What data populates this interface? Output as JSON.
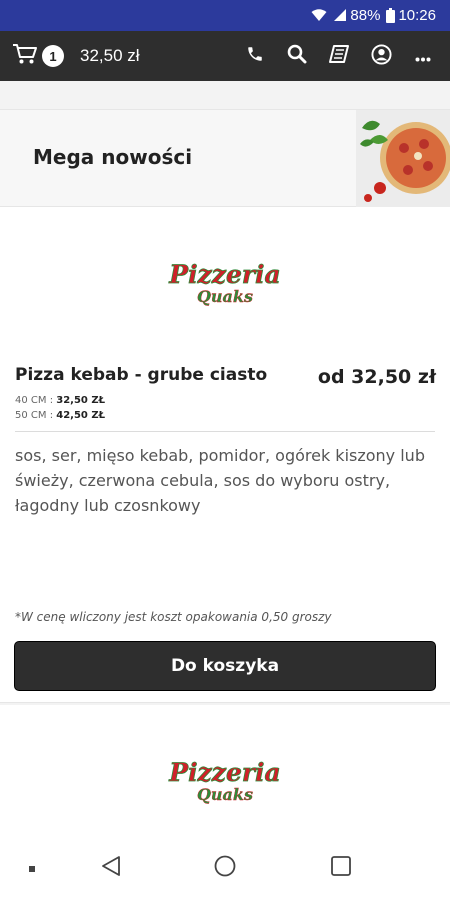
{
  "status_bar": {
    "battery": "88%",
    "time": "10:26"
  },
  "app_bar": {
    "cart_count": "1",
    "cart_total": "32,50 zł"
  },
  "category": {
    "title": "Mega nowości"
  },
  "product": {
    "logo_line1": "Pizzeria",
    "logo_line2": "Quaks",
    "name": "Pizza kebab - grube ciasto",
    "price": "od 32,50 zł",
    "sizes": [
      {
        "label": "40 CM :",
        "price": "32,50 ZŁ"
      },
      {
        "label": "50 CM :",
        "price": "42,50 ZŁ"
      }
    ],
    "description": "sos, ser, mięso kebab, pomidor, ogórek kiszony lub świeży, czerwona cebula, sos do wyboru ostry, łagodny lub czosnkowy",
    "note": "*W cenę wliczony jest koszt opakowania 0,50 groszy",
    "button": "Do koszyka"
  },
  "product2": {
    "logo_line1": "Pizzeria",
    "logo_line2": "Quaks"
  },
  "colors": {
    "status_bar": "#2c3a9c",
    "app_bar": "#2e2e2e",
    "logo_red": "#d0202a",
    "logo_green": "#2e8b3a"
  }
}
